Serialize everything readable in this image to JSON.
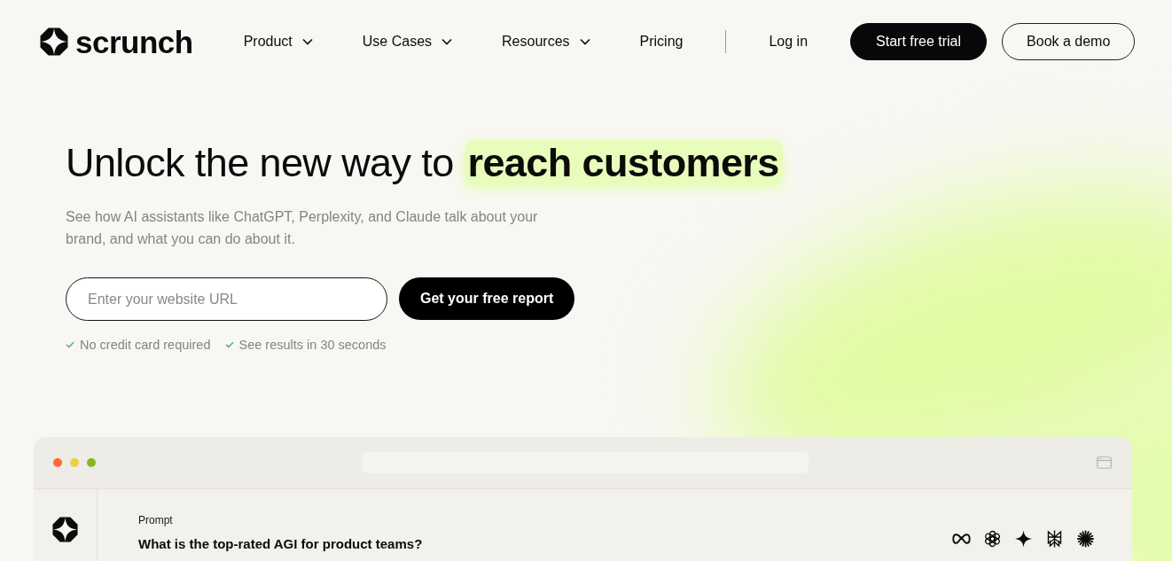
{
  "header": {
    "logo": "scrunch",
    "nav": [
      {
        "label": "Product",
        "dropdown": true
      },
      {
        "label": "Use Cases",
        "dropdown": true
      },
      {
        "label": "Resources",
        "dropdown": true
      },
      {
        "label": "Pricing",
        "dropdown": false
      }
    ],
    "login": "Log in",
    "buttons": [
      {
        "label": "Start free trial",
        "kind": "primary"
      },
      {
        "label": "Book a demo",
        "kind": "outline"
      }
    ]
  },
  "hero": {
    "headline": "Unlock the new way to **reach customers**",
    "subtitle": "See how AI assistants like ChatGPT, Perplexity, and Claude talk about your brand, and what you can do about it.",
    "url_field": {
      "placeholder": "Enter your website URL"
    },
    "submit": "Get your free report",
    "perks": [
      "No credit card required",
      "See results in 30 seconds"
    ]
  },
  "preview": {
    "window_dots": [
      {
        "color": "#fb6b3a"
      },
      {
        "color": "#efcf45"
      },
      {
        "color": "#86b71d"
      }
    ],
    "prompt_label": "Prompt",
    "prompt": "What is the top-rated AGI for product teams?"
  }
}
